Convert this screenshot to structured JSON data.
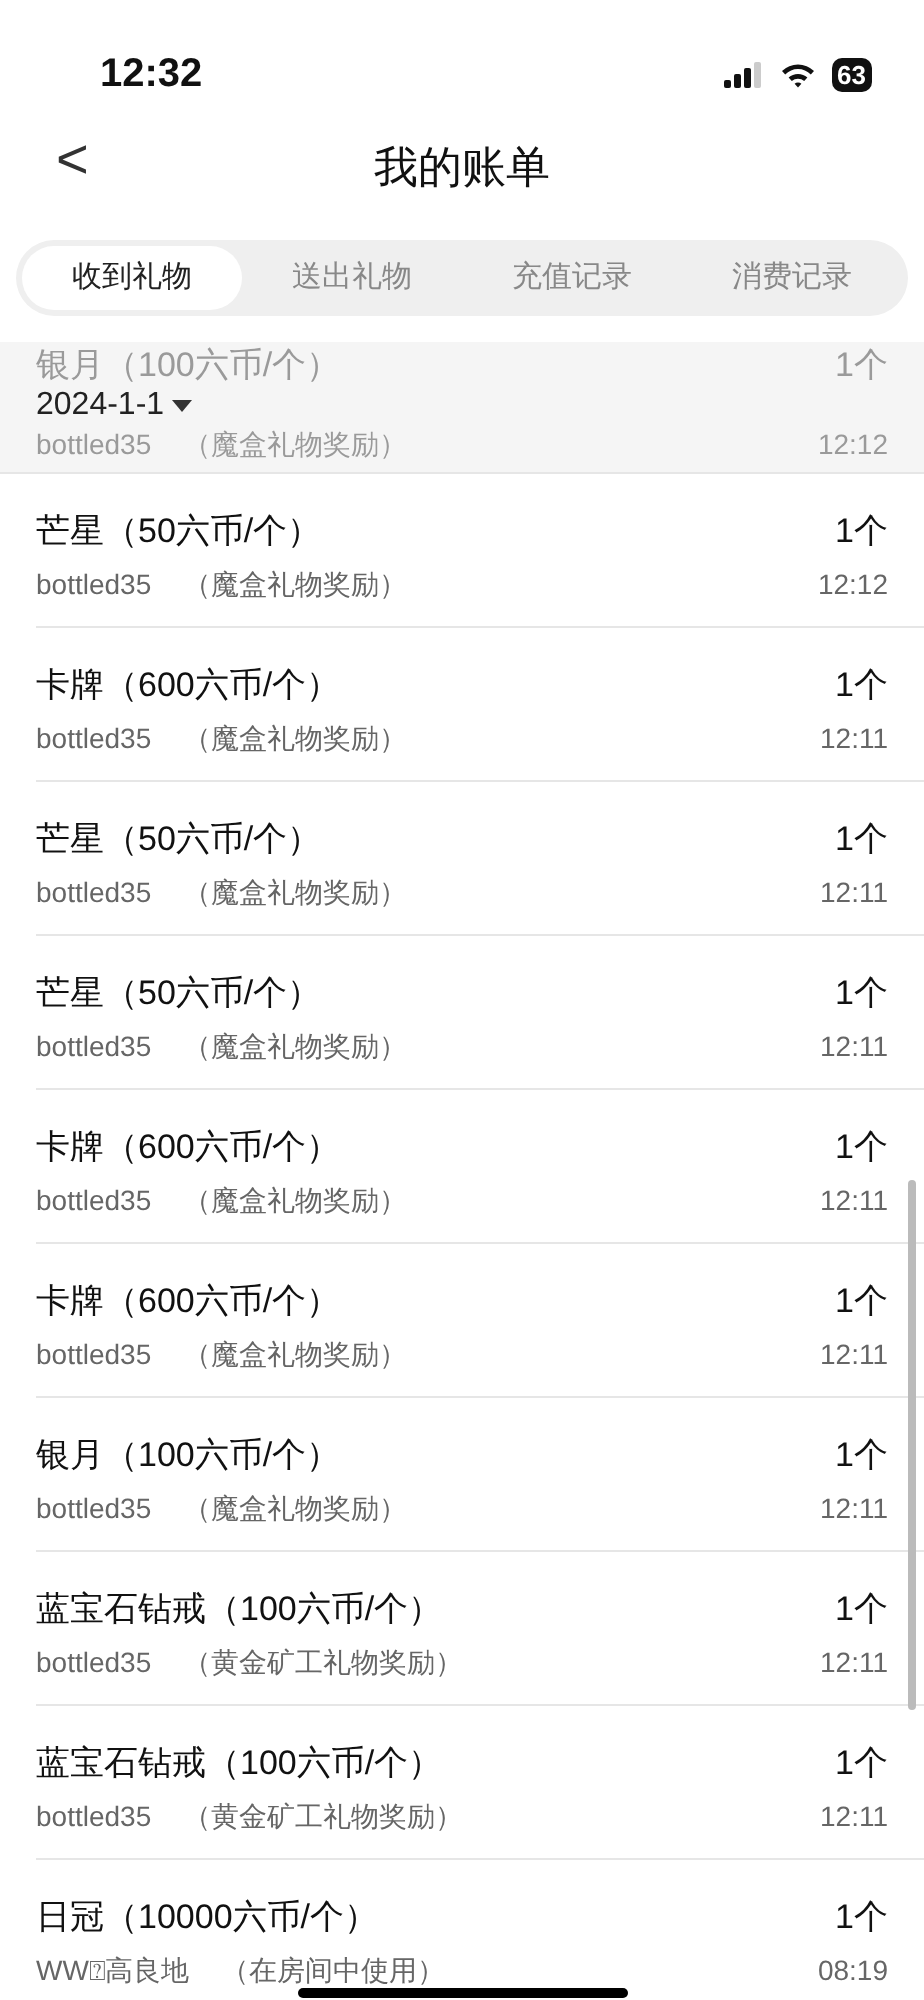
{
  "status_bar": {
    "time": "12:32",
    "battery": "63"
  },
  "header": {
    "back": "<",
    "title": "我的账单"
  },
  "tabs": [
    {
      "label": "收到礼物",
      "selected": true
    },
    {
      "label": "送出礼物",
      "selected": false
    },
    {
      "label": "充值记录",
      "selected": false
    },
    {
      "label": "消费记录",
      "selected": false
    }
  ],
  "date_filter": {
    "label": "2024-1-1"
  },
  "records": [
    {
      "name": "银月（100六币/个）",
      "source": "bottled35",
      "note": "（魔盒礼物奖励）",
      "count": "1个",
      "time": "12:12",
      "faded": true
    },
    {
      "name": "芒星（50六币/个）",
      "source": "bottled35",
      "note": "（魔盒礼物奖励）",
      "count": "1个",
      "time": "12:12",
      "faded": false
    },
    {
      "name": "卡牌（600六币/个）",
      "source": "bottled35",
      "note": "（魔盒礼物奖励）",
      "count": "1个",
      "time": "12:11",
      "faded": false
    },
    {
      "name": "芒星（50六币/个）",
      "source": "bottled35",
      "note": "（魔盒礼物奖励）",
      "count": "1个",
      "time": "12:11",
      "faded": false
    },
    {
      "name": "芒星（50六币/个）",
      "source": "bottled35",
      "note": "（魔盒礼物奖励）",
      "count": "1个",
      "time": "12:11",
      "faded": false
    },
    {
      "name": "卡牌（600六币/个）",
      "source": "bottled35",
      "note": "（魔盒礼物奖励）",
      "count": "1个",
      "time": "12:11",
      "faded": false
    },
    {
      "name": "卡牌（600六币/个）",
      "source": "bottled35",
      "note": "（魔盒礼物奖励）",
      "count": "1个",
      "time": "12:11",
      "faded": false
    },
    {
      "name": "银月（100六币/个）",
      "source": "bottled35",
      "note": "（魔盒礼物奖励）",
      "count": "1个",
      "time": "12:11",
      "faded": false
    },
    {
      "name": "蓝宝石钻戒（100六币/个）",
      "source": "bottled35",
      "note": "（黄金矿工礼物奖励）",
      "count": "1个",
      "time": "12:11",
      "faded": false
    },
    {
      "name": "蓝宝石钻戒（100六币/个）",
      "source": "bottled35",
      "note": "（黄金矿工礼物奖励）",
      "count": "1个",
      "time": "12:11",
      "faded": false
    },
    {
      "name": "日冠（10000六币/个）",
      "source": "WW⍰高良地",
      "note": "（在房间中使用）",
      "count": "1个",
      "time": "08:19",
      "faded": false
    }
  ]
}
